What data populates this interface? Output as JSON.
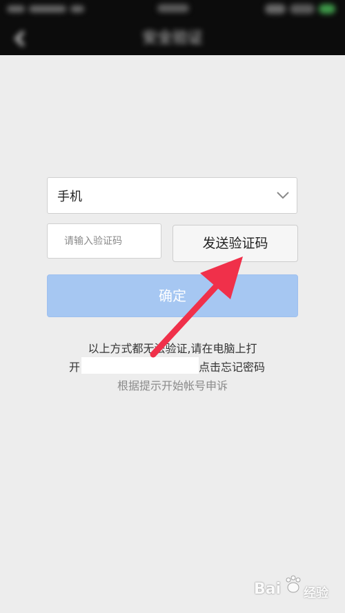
{
  "header": {
    "title": "安全验证",
    "back_icon": "chevron-left-icon"
  },
  "form": {
    "phone_label": "手机",
    "code_placeholder": "请输入验证码",
    "send_code_label": "发送验证码",
    "confirm_label": "确定"
  },
  "hint": {
    "line1": "以上方式都无法验证,请在电脑上打",
    "line2_prefix": "开",
    "line2_suffix": "点击忘记密码",
    "line3": "根据提示开始帐号申诉"
  },
  "watermark": {
    "brand": "Bai",
    "product": "经验"
  },
  "colors": {
    "confirm_button": "#a6c7f2",
    "annotation_arrow": "#f0304a",
    "header": "#0c0c0c",
    "background": "#ededed"
  }
}
